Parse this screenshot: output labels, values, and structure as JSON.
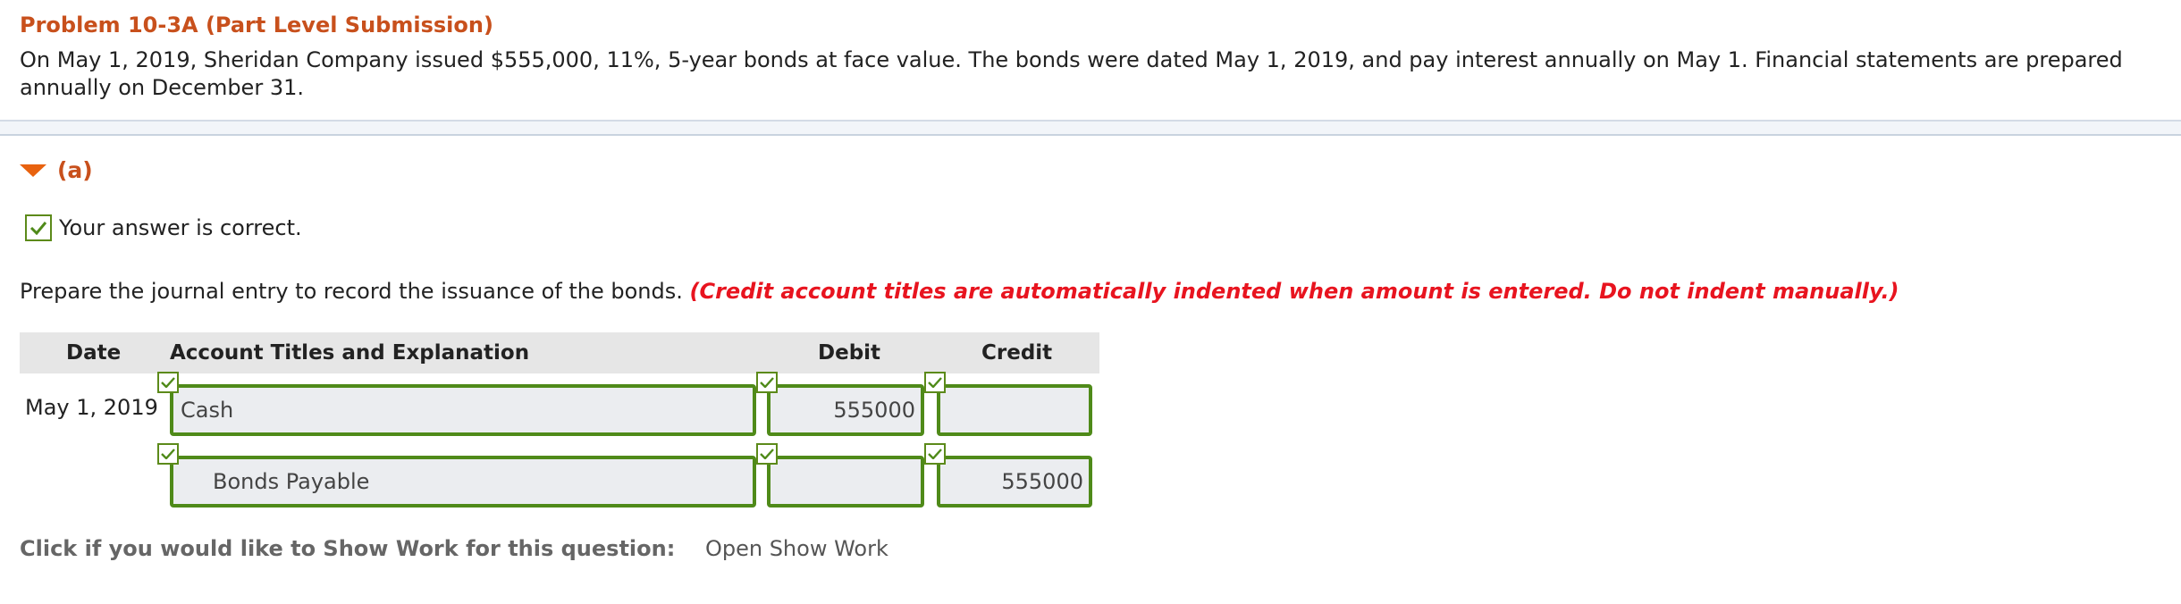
{
  "problem": {
    "title": "Problem 10-3A (Part Level Submission)",
    "text": "On May 1, 2019, Sheridan Company issued $555,000, 11%, 5-year bonds at face value. The bonds were dated May 1, 2019, and pay interest annually on May 1. Financial statements are prepared annually on December 31."
  },
  "part": {
    "label": "(a)",
    "status": "Your answer is correct.",
    "instruction": "Prepare the journal entry to record the issuance of the bonds.",
    "instruction_note": "(Credit account titles are automatically indented when amount is entered. Do not indent manually.)"
  },
  "table": {
    "headers": {
      "date": "Date",
      "account": "Account Titles and Explanation",
      "debit": "Debit",
      "credit": "Credit"
    },
    "rows": [
      {
        "date": "May 1, 2019",
        "account": "Cash",
        "debit": "555000",
        "credit": ""
      },
      {
        "date": "",
        "account": "Bonds Payable",
        "debit": "",
        "credit": "555000"
      }
    ]
  },
  "show_work": {
    "label": "Click if you would like to Show Work for this question:",
    "link": "Open Show Work"
  },
  "colors": {
    "title_orange": "#c8501c",
    "note_red": "#e8141f",
    "correct_green": "#4f8a19"
  }
}
